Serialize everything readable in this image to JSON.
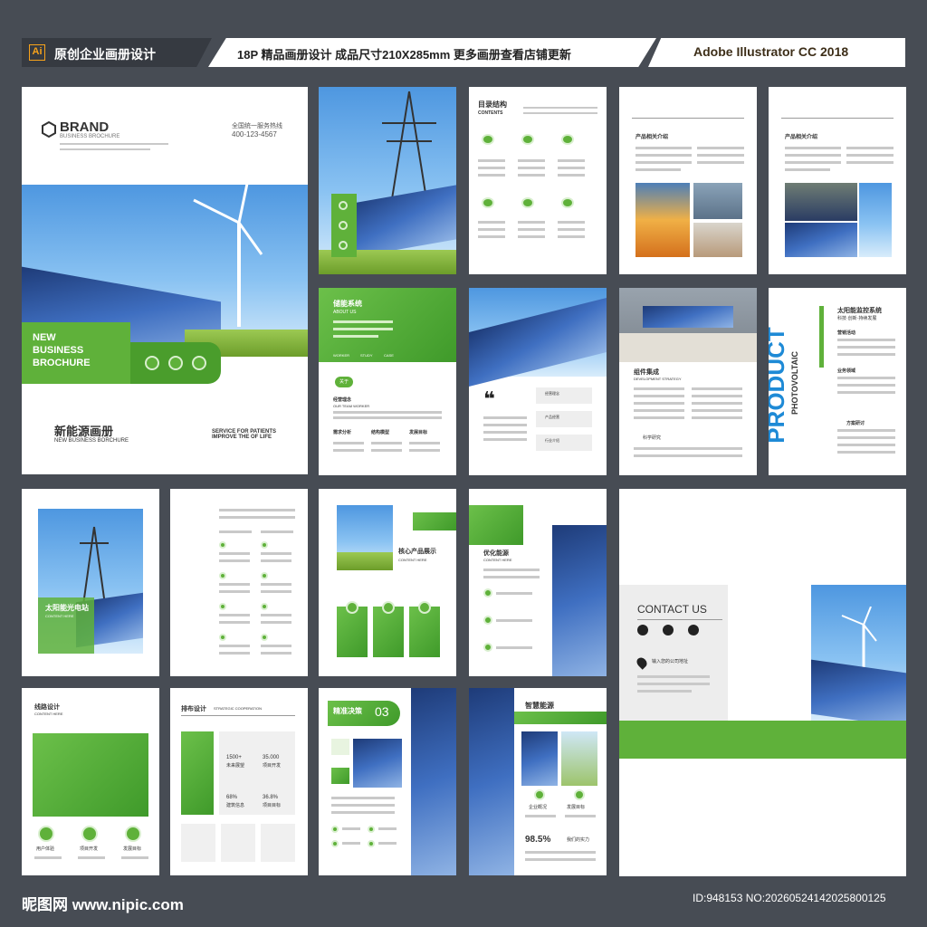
{
  "header": {
    "ai_badge": "Ai",
    "title": "原创企业画册设计",
    "spec": "18P 精品画册设计  成品尺寸210X285mm  更多画册查看店铺更新",
    "software": "Adobe Illustrator CC 2018"
  },
  "cover": {
    "brand": "BRAND",
    "brand_sub": "BUSINESS BROCHURE",
    "hotline_label": "全国统一服务热线",
    "hotline": "400-123-4567",
    "banner": "NEW\nBUSINESS\nBROCHURE",
    "title_cn": "新能源画册",
    "title_en": "NEW BUSINESS BORCHURE",
    "service": "SERVICE FOR PATIENTS\nIMPROVE THE OF LIFE"
  },
  "pages": {
    "contents_title": "目录结构",
    "contents_en": "CONTENTS",
    "product_intro": "产品相关介绍",
    "storage_title": "储能系统",
    "storage_en": "ABOUT US",
    "storage_tabs": [
      "WORKER",
      "STUDY",
      "CASE"
    ],
    "about_badge": "关于",
    "manage_title": "经营理念",
    "manage_en": "OUR TEAM WORKER",
    "cols": [
      "需求分析",
      "结构模型",
      "发展目标"
    ],
    "quote_items": [
      "经营理念",
      "产品经营",
      "行业介绍"
    ],
    "module_title": "组件集成",
    "module_en": "DEVELOPMENT STRATEGY",
    "science": "科学研究",
    "product_word": "PRODUCT",
    "photovoltaic": "PHOTOVOLTAIC",
    "solar_monitor": "太阳能监控系统",
    "solar_sub": "科技·创新·持续发展",
    "ops": "营销活动",
    "biz": "业务领域",
    "plan": "方案研讨",
    "solar_power": "太阳能光电站",
    "core_title": "核心产品展示",
    "core_en": "CONTENT HERE",
    "optimize_title": "优化能源",
    "optimize_en": "CONTENT HERE",
    "contact": "CONTACT US",
    "input_address": "输入您的公司地址",
    "route_title": "线路设计",
    "route_en": "CONTENT HERE",
    "route_items": [
      "用户体验",
      "项目开发",
      "发展目标"
    ],
    "layout_title": "排布设计",
    "layout_en": "STRATEGIC COOPERATION",
    "stats": [
      "1500+",
      "35.000",
      "68%",
      "36.8%"
    ],
    "stat_labels": [
      "未来展望",
      "项目开发",
      "建筑信息",
      "项目目标"
    ],
    "precise_title": "精准决策",
    "precise_num": "03",
    "smart_title": "智慧能源",
    "smart_labels": [
      "企业概况",
      "发展目标"
    ],
    "pct": "98.5%",
    "pct_label": "我们的实力"
  },
  "footer": {
    "site": "昵图网 www.nipic.com",
    "id": "ID:948153 NO:20260524142025800125"
  }
}
